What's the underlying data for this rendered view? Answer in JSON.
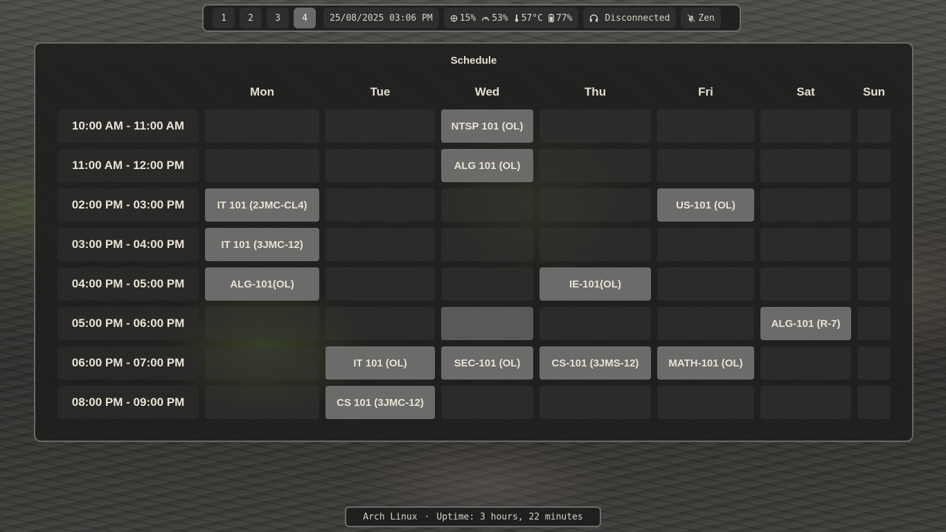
{
  "topbar": {
    "workspaces": [
      "1",
      "2",
      "3",
      "4"
    ],
    "active_workspace": "4",
    "datetime": "25/08/2025 03:06 PM",
    "cpu": "15%",
    "memory": "53%",
    "temperature": "57°C",
    "battery": "77%",
    "headset_status": "Disconnected",
    "notification_mode": "Zen",
    "icons": {
      "cpu": "cpu-icon",
      "memory": "memory-gauge-icon",
      "temperature": "thermometer-icon",
      "battery": "battery-icon",
      "headset": "headphones-icon",
      "notification": "bell-off-icon"
    }
  },
  "schedule": {
    "title": "Schedule",
    "days": [
      "Mon",
      "Tue",
      "Wed",
      "Thu",
      "Fri",
      "Sat",
      "Sun"
    ],
    "times": [
      "10:00 AM - 11:00 AM",
      "11:00 AM - 12:00 PM",
      "02:00 PM - 03:00 PM",
      "03:00 PM - 04:00 PM",
      "04:00 PM - 05:00 PM",
      "05:00 PM - 06:00 PM",
      "06:00 PM - 07:00 PM",
      "08:00 PM - 09:00 PM"
    ],
    "grid": [
      [
        "",
        "",
        "NTSP 101 (OL)",
        "",
        "",
        "",
        ""
      ],
      [
        "",
        "",
        "ALG 101 (OL)",
        "",
        "",
        "",
        ""
      ],
      [
        "IT 101 (2JMC-CL4)",
        "",
        "",
        "",
        "US-101 (OL)",
        "",
        ""
      ],
      [
        "IT 101 (3JMC-12)",
        "",
        "",
        "",
        "",
        "",
        ""
      ],
      [
        "ALG-101(OL)",
        "",
        "",
        "IE-101(OL)",
        "",
        "",
        ""
      ],
      [
        "",
        "",
        "",
        "",
        "",
        "ALG-101 (R-7)",
        ""
      ],
      [
        "",
        "IT 101 (OL)",
        "SEC-101 (OL)",
        "CS-101 (3JMS-12)",
        "MATH-101 (OL)",
        "",
        ""
      ],
      [
        "",
        "CS 101 (3JMC-12)",
        "",
        "",
        "",
        "",
        ""
      ]
    ],
    "highlighted_empty_cells": [
      [
        5,
        2
      ]
    ]
  },
  "bottombar": {
    "os": "Arch Linux",
    "separator": "·",
    "uptime": "Uptime: 3 hours, 22 minutes"
  },
  "colors": {
    "bar_background": "#1e1e1e",
    "bar_border": "#6f6d68",
    "active_workspace": "#6a6a6a",
    "filled_cell": "#6b6b6a",
    "text": "#e8e2d2"
  }
}
